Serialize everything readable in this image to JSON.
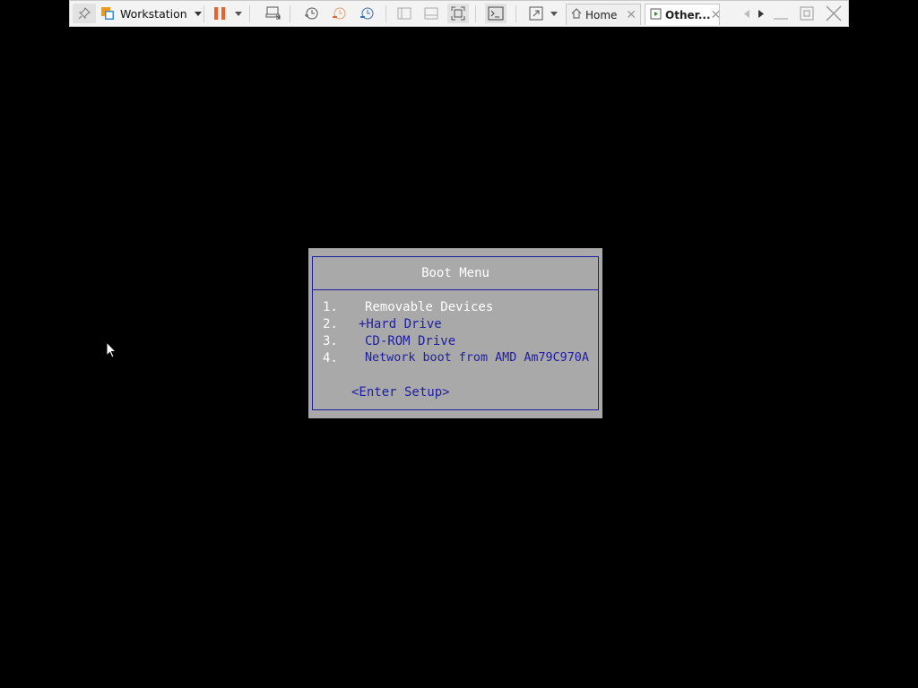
{
  "toolbar": {
    "app_label": "Workstation",
    "tabs": [
      {
        "label": "Home",
        "close": "✕"
      },
      {
        "label": "Other...",
        "close": "✕"
      }
    ]
  },
  "boot_menu": {
    "title": "Boot Menu",
    "items": [
      {
        "num": "1.",
        "label": "Removable Devices",
        "selected": true
      },
      {
        "num": "2.",
        "label": "+Hard Drive",
        "selected": false
      },
      {
        "num": "3.",
        "label": "CD-ROM Drive",
        "selected": false
      },
      {
        "num": "4.",
        "label": "Network boot from AMD Am79C970A",
        "selected": false
      }
    ],
    "setup": "<Enter Setup>"
  },
  "colors": {
    "bios_blue": "#1e1ea0",
    "bios_gray": "#a9a9a9",
    "pause_orange": "#e8622a",
    "vm_tab_green": "#3a8a2e"
  }
}
